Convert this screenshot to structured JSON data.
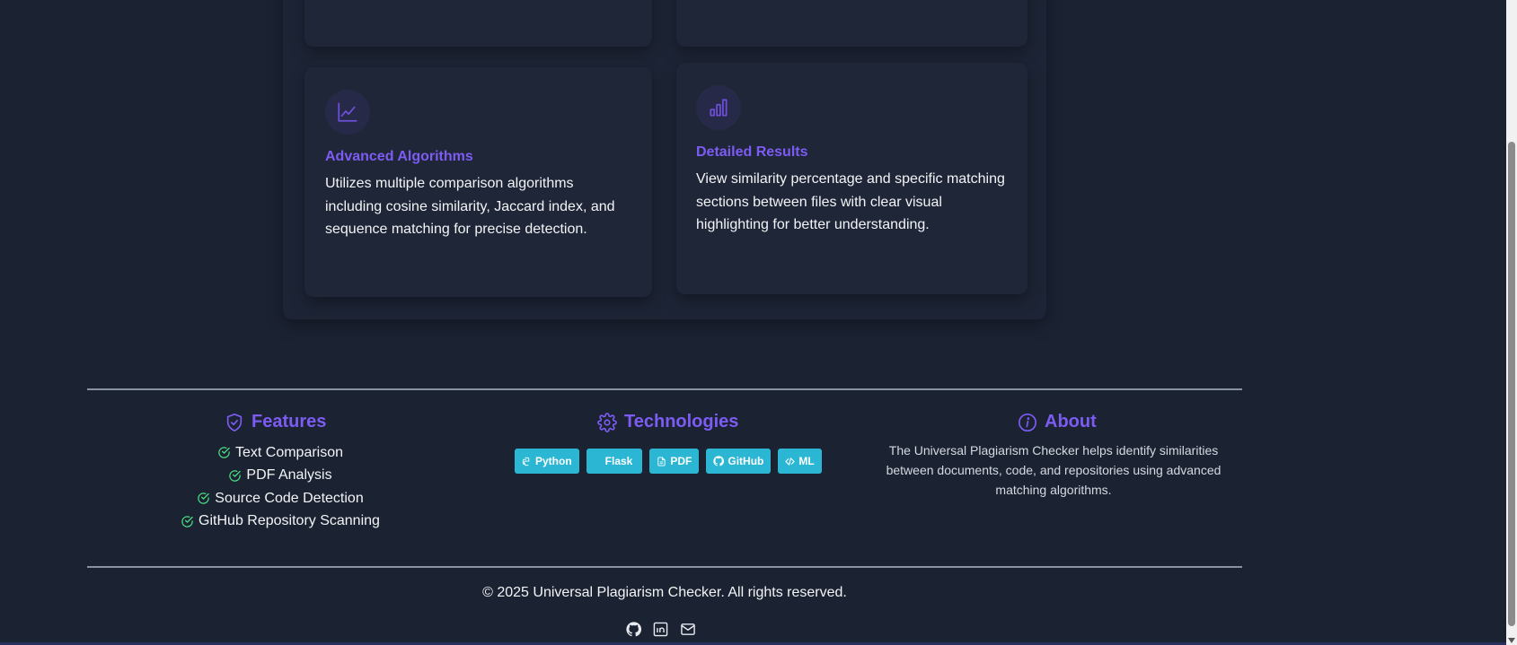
{
  "features_section": {
    "cards": [
      {
        "icon": "line-chart-icon",
        "title": "Advanced Algorithms",
        "description_lines": [
          "Utilizes multiple comparison algorithms",
          "including cosine similarity, Jaccard index, and",
          "sequence matching for precise detection."
        ]
      },
      {
        "icon": "bar-chart-icon",
        "title": "Detailed Results",
        "description_lines": [
          "View similarity percentage and specific matching",
          "sections between files with clear visual",
          "highlighting for better understanding."
        ]
      }
    ]
  },
  "footer": {
    "features": {
      "icon": "shield-check-icon",
      "title": "Features",
      "items": [
        "Text Comparison",
        "PDF Analysis",
        "Source Code Detection",
        "GitHub Repository Scanning"
      ]
    },
    "technologies": {
      "icon": "gear-icon",
      "title": "Technologies",
      "badges": [
        {
          "icon": "python-icon",
          "label": "Python"
        },
        {
          "icon": "flask-icon",
          "label": "Flask"
        },
        {
          "icon": "file-icon",
          "label": "PDF"
        },
        {
          "icon": "github-icon",
          "label": "GitHub"
        },
        {
          "icon": "code-icon",
          "label": "ML"
        }
      ]
    },
    "about": {
      "icon": "info-icon",
      "title": "About",
      "text": "The Universal Plagiarism Checker helps identify similarities between documents, code, and repositories using advanced matching algorithms."
    },
    "copyright": "© 2025 Universal Plagiarism Checker. All rights reserved.",
    "social_links": [
      "github-icon",
      "linkedin-icon",
      "mail-icon"
    ]
  },
  "colors": {
    "background": "#1b2232",
    "card": "#1f2638",
    "accent": "#7c5cf2",
    "badge": "#2bb6d4",
    "check": "#4ade80"
  }
}
